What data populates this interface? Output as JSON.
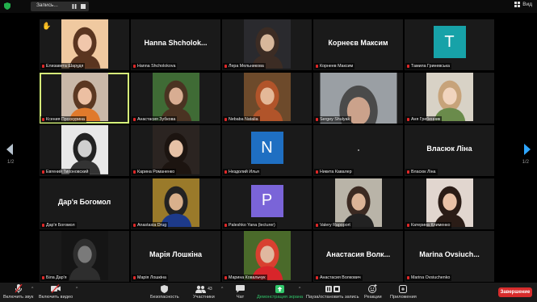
{
  "topbar": {
    "recording_label": "Запись...",
    "view_label": "Вид"
  },
  "pagination": {
    "left": "1/2",
    "right": "1/2"
  },
  "tiles": [
    {
      "name": "Елизавета Шарудя",
      "hand": "✋",
      "pic": {
        "bg": "#f0c9a0",
        "hair": "#5a3520",
        "skin": "#f1c7ab"
      }
    },
    {
      "name": "Hanna Shcholokova",
      "display": "Hanna  Shcholok..."
    },
    {
      "name": "Лера Мельникова",
      "pic": {
        "bg": "#2a2a2e",
        "hair": "#3c2c24",
        "skin": "#d7b79b"
      }
    },
    {
      "name": "Корнеев Максим",
      "display": "Корнеєв Максим"
    },
    {
      "name": "Тамила Гриневська",
      "letter": "T",
      "letter_bg": "#17a2a8"
    },
    {
      "name": "Ксения Проскурина",
      "active": true,
      "pic": {
        "bg": "#c9b8a8",
        "hair": "#5b3822",
        "skin": "#ecbfa2",
        "shirt": "#e07a2c"
      }
    },
    {
      "name": "Анастасия Зубкова",
      "pic": {
        "bg": "#3f6b35",
        "hair": "#4a3322",
        "skin": "#d8ad92"
      }
    },
    {
      "name": "Nebaba Natalia",
      "pic": {
        "bg": "#6d4a2b",
        "hair": "#b1542a",
        "skin": "#e4b898"
      }
    },
    {
      "name": "Sergey Shulyak",
      "wide": true,
      "pic": {
        "bg": "#9a9fa4",
        "hair": "#4a4a4a",
        "skin": "#cba28b",
        "shirt": "#222"
      }
    },
    {
      "name": "Аня Гребенник",
      "pic": {
        "bg": "#d8d2c6",
        "hair": "#c7a37a",
        "skin": "#f1d4be",
        "shirt": "#6a8b4b"
      }
    },
    {
      "name": "Евгений Тихоновский",
      "pic": {
        "bg": "#e8e8e8",
        "hair": "#222",
        "skin": "#cfcfcf",
        "shirt": "#333"
      }
    },
    {
      "name": "Карина Романенко",
      "pic": {
        "bg": "#2b2421",
        "hair": "#1c1410",
        "skin": "#e6c1a6"
      }
    },
    {
      "name": "Нездолий Илья",
      "letter": "N",
      "letter_bg": "#1f6fc2"
    },
    {
      "name": "Никита Кавалер",
      "dot": true
    },
    {
      "name": "Власюк Ліна",
      "display": "Власюк Ліна"
    },
    {
      "name": "Дар'я Богомол",
      "display": "Дар'я Богомол"
    },
    {
      "name": "Anastasia Drug",
      "pic": {
        "bg": "#9a7a2a",
        "hair": "#222",
        "skin": "#d9b08c",
        "shirt": "#1d3a8a"
      }
    },
    {
      "name": "Paleshko Yana (lecturer)",
      "letter": "P",
      "letter_bg": "#7a64d8"
    },
    {
      "name": "Valery Rapoport",
      "pic": {
        "bg": "#b9b4a8",
        "hair": "#3b2a22",
        "skin": "#dcb497",
        "shirt": "#222"
      }
    },
    {
      "name": "Катерина Клименко",
      "pic": {
        "bg": "#e1d6cf",
        "hair": "#2a1c16",
        "skin": "#e9c2a7"
      }
    },
    {
      "name": "Біла Дар'я",
      "pic": {
        "bg": "#151515",
        "hair": "#2e2e2e",
        "skin": "#7a7a7a"
      }
    },
    {
      "name": "Марія Лошкіна",
      "display": "Марія Лошкіна"
    },
    {
      "name": "Марина Ковальчук",
      "pic": {
        "bg": "#4a6a2a",
        "hair": "#d84030",
        "skin": "#e0b8a0",
        "shirt": "#d8252a"
      }
    },
    {
      "name": "Анастасия Волкович",
      "display": "Анастасия  Волк..."
    },
    {
      "name": "Marina Ovsiuchenko",
      "display": "Marina  Ovsiuch..."
    }
  ],
  "toolbar": {
    "mute": "Включить звук",
    "video": "Включить видео",
    "security": "Безопасность",
    "participants": "Участники",
    "participants_count": "43",
    "chat": "Чат",
    "share": "Демонстрация экрана",
    "record": "Пауза/остановить запись",
    "reactions": "Реакции",
    "apps": "Приложения",
    "end": "Завершение"
  },
  "colors": {
    "accent_green": "#31c66a",
    "end_red": "#d72c2c",
    "active_border": "#d6f57a"
  }
}
